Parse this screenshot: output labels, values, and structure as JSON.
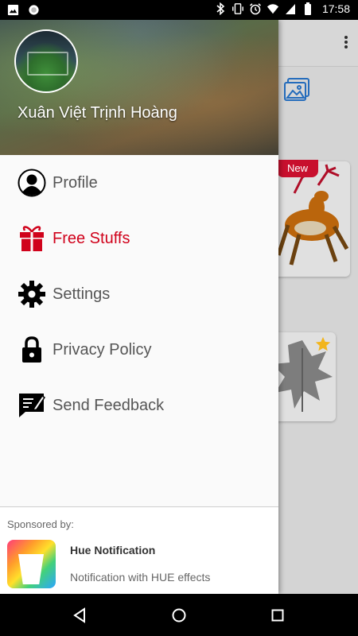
{
  "status_bar": {
    "time": "17:58",
    "icons": [
      "image-icon",
      "circle-icon",
      "bluetooth-icon",
      "vibrate-icon",
      "alarm-icon",
      "wifi-icon",
      "signal-icon",
      "battery-icon"
    ]
  },
  "drawer": {
    "username": "Xuân Việt Trịnh Hoàng",
    "menu": [
      {
        "label": "Profile",
        "icon": "person-icon"
      },
      {
        "label": "Free Stuffs",
        "icon": "gift-icon",
        "active": true
      },
      {
        "label": "Settings",
        "icon": "gear-icon"
      },
      {
        "label": "Privacy Policy",
        "icon": "lock-icon"
      },
      {
        "label": "Send Feedback",
        "icon": "feedback-icon"
      }
    ],
    "sponsor": {
      "title": "Sponsored by:",
      "app_name": "Hue Notification",
      "app_description": "Notification with HUE effects"
    }
  },
  "background": {
    "badge_new": "New"
  },
  "colors": {
    "accent": "#d0021b",
    "new_badge": "#c8102e",
    "star": "#f2b51c"
  }
}
